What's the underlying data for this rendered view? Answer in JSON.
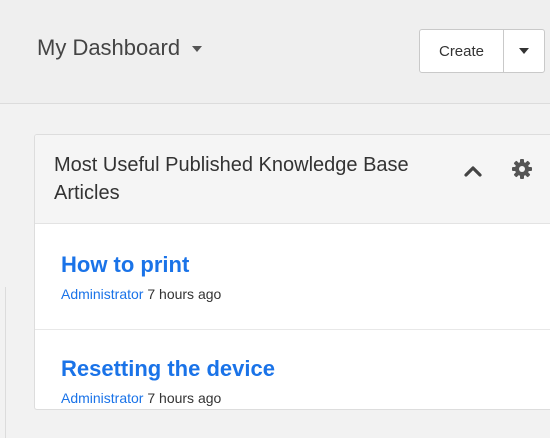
{
  "header": {
    "title": "My Dashboard",
    "create_label": "Create"
  },
  "widget": {
    "title": "Most Useful Published Knowledge Base Articles",
    "articles": [
      {
        "title": "How to print",
        "author": "Administrator",
        "time": "7 hours ago"
      },
      {
        "title": "Resetting the device",
        "author": "Administrator",
        "time": "7 hours ago"
      }
    ]
  },
  "colors": {
    "link": "#1a73e8",
    "background": "#f2f2f2",
    "panel": "#ffffff"
  },
  "icons": [
    "chevron-down-icon",
    "chevron-up-icon",
    "gear-icon"
  ]
}
